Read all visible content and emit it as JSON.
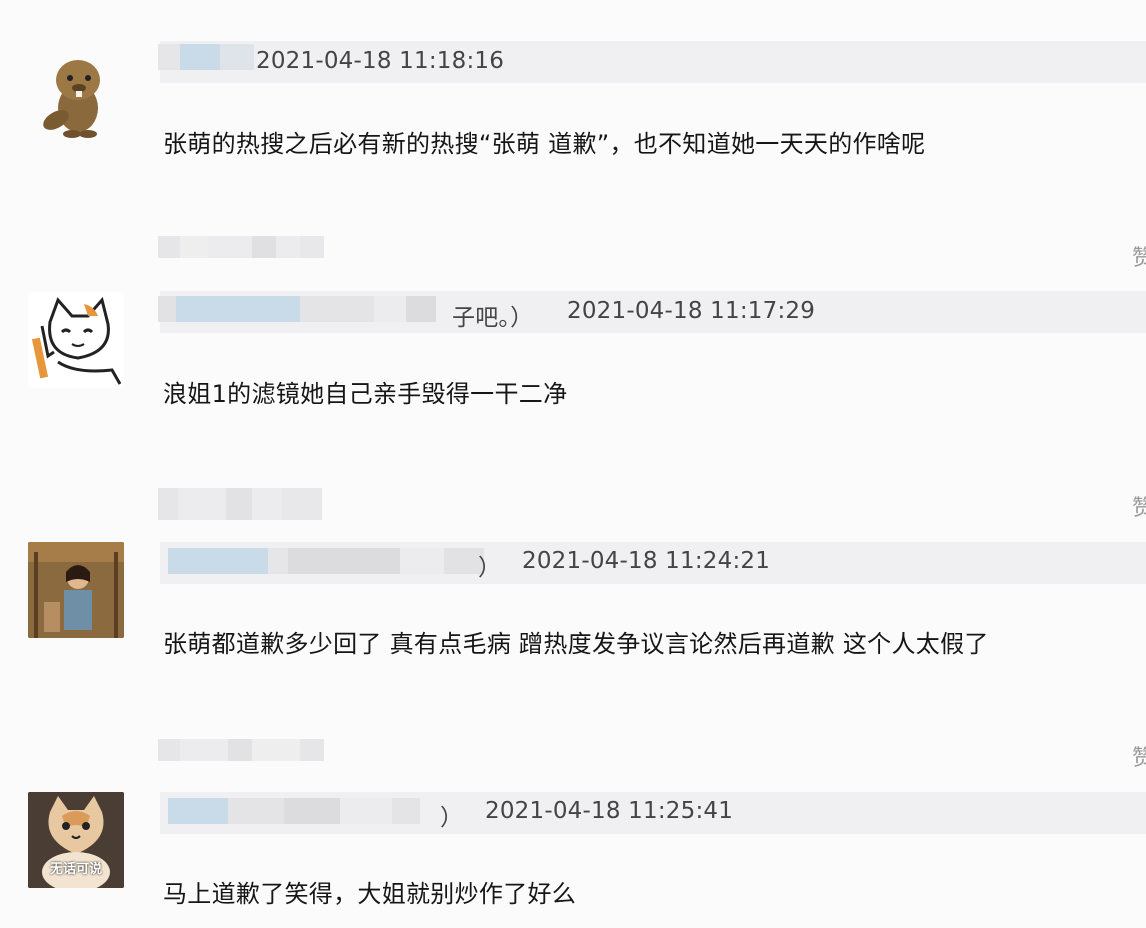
{
  "comments": [
    {
      "avatar_icon": "cartoon-beaver-icon",
      "name_tail": "",
      "timestamp": "2021-04-18 11:18:16",
      "text": "张萌的热搜之后必有新的热搜“张萌 道歉”，也不知道她一天天的作啥呢"
    },
    {
      "avatar_icon": "cartoon-cat-icon",
      "name_tail": "子吧。）",
      "timestamp": "2021-04-18 11:17:29",
      "text": "浪姐1的滤镜她自己亲手毁得一干二净"
    },
    {
      "avatar_icon": "photo-person-icon",
      "name_tail": "）",
      "timestamp": "2021-04-18 11:24:21",
      "text": "张萌都道歉多少回了 真有点毛病 蹭热度发争议言论然后再道歉 这个人太假了"
    },
    {
      "avatar_icon": "cat-meme-photo-icon",
      "avatar_caption": "无话可说",
      "name_tail": "）",
      "timestamp": "2021-04-18 11:25:41",
      "text": "马上道歉了笑得，大姐就别炒作了好么"
    }
  ],
  "reply_glyph": "赞",
  "colors": {
    "background": "#fbfbfc",
    "meta_bar": "#f0f0f2",
    "blur_blue": "#c9dbe8",
    "blur_gray": "#e4e4e6",
    "text": "#161616",
    "meta_text": "#444444"
  }
}
